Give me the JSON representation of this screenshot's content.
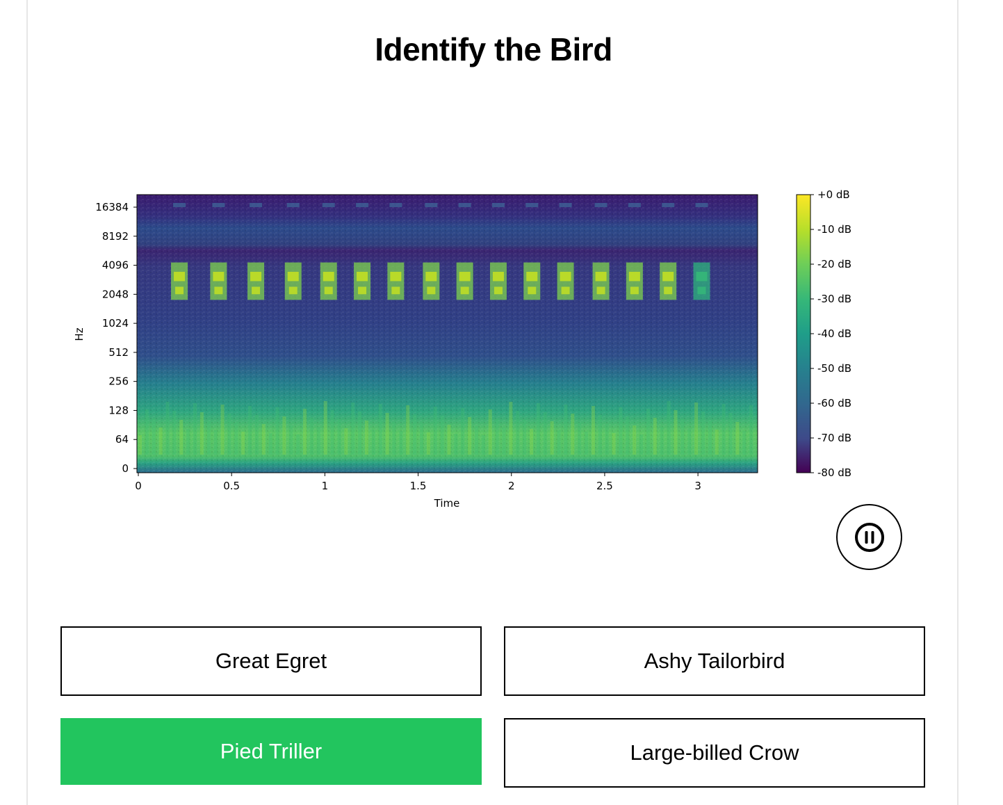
{
  "header": {
    "title": "Identify the Bird"
  },
  "player": {
    "pause_icon": "pause-icon"
  },
  "options": [
    {
      "label": "Great Egret",
      "selected": false
    },
    {
      "label": "Ashy Tailorbird",
      "selected": false
    },
    {
      "label": "Pied Triller",
      "selected": true
    },
    {
      "label": "Large-billed Crow",
      "selected": false
    }
  ],
  "colors": {
    "selected": "#22c55e",
    "border": "#000000"
  },
  "chart_data": {
    "type": "heatmap",
    "title": "",
    "xlabel": "Time",
    "ylabel": "Hz",
    "x_ticks": [
      0,
      0.5,
      1,
      1.5,
      2,
      2.5,
      3
    ],
    "x_tick_labels": [
      "0",
      "0.5",
      "1",
      "1.5",
      "2",
      "2.5",
      "3"
    ],
    "xlim": [
      0,
      3.32
    ],
    "y_tick_labels": [
      "0",
      "64",
      "128",
      "256",
      "512",
      "1024",
      "2048",
      "4096",
      "8192",
      "16384"
    ],
    "y_scale": "log",
    "colorbar": {
      "labels": [
        "+0 dB",
        "-10 dB",
        "-20 dB",
        "-30 dB",
        "-40 dB",
        "-50 dB",
        "-60 dB",
        "-70 dB",
        "-80 dB"
      ],
      "range": [
        -80,
        0
      ],
      "colormap": "viridis"
    },
    "call_times": [
      0.22,
      0.43,
      0.63,
      0.83,
      1.02,
      1.2,
      1.38,
      1.57,
      1.75,
      1.93,
      2.11,
      2.29,
      2.48,
      2.66,
      2.84,
      3.02
    ],
    "call_band_hz": [
      2048,
      4096
    ]
  }
}
